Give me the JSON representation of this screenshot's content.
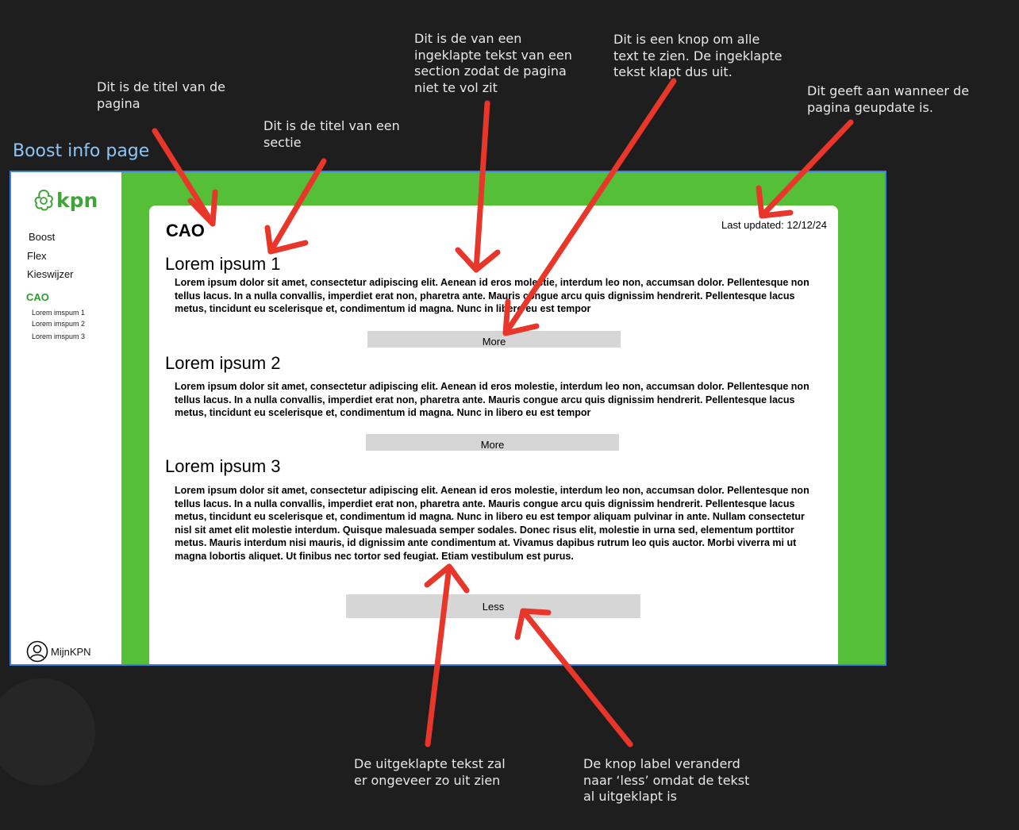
{
  "frame_title": "Boost info page",
  "colors": {
    "brand_green": "#55bf37",
    "frame_border": "#3b82e0",
    "arrow_red": "#e8362a"
  },
  "sidebar": {
    "logo_text": "kpn",
    "items": [
      {
        "label": "Boost"
      },
      {
        "label": "Flex"
      },
      {
        "label": "Kieswijzer"
      },
      {
        "label": "CAO",
        "active": true
      }
    ],
    "subitems": [
      {
        "label": "Lorem imspum 1"
      },
      {
        "label": "Lorem imspum 2"
      },
      {
        "label": "Lorem imspum 3"
      }
    ],
    "account_label": "MijnKPN"
  },
  "page": {
    "title": "CAO",
    "last_updated": "Last updated: 12/12/24",
    "sections": [
      {
        "title": "Lorem ipsum 1",
        "body": "Lorem ipsum dolor sit amet, consectetur adipiscing elit. Aenean id eros molestie, interdum leo non, accumsan dolor. Pellentesque non tellus lacus. In a nulla convallis, imperdiet erat non, pharetra ante. Mauris congue arcu quis dignissim hendrerit. Pellentesque lacus metus, tincidunt eu scelerisque et, condimentum id magna. Nunc in libero eu est tempor",
        "button": "More"
      },
      {
        "title": "Lorem ipsum 2",
        "body": "Lorem ipsum dolor sit amet, consectetur adipiscing elit. Aenean id eros molestie, interdum leo non, accumsan dolor. Pellentesque non tellus lacus. In a nulla convallis, imperdiet erat non, pharetra ante. Mauris congue arcu quis dignissim hendrerit. Pellentesque lacus metus, tincidunt eu scelerisque et, condimentum id magna. Nunc in libero eu est tempor",
        "button": "More"
      },
      {
        "title": "Lorem ipsum 3",
        "body": "Lorem ipsum dolor sit amet, consectetur adipiscing elit. Aenean id eros molestie, interdum leo non, accumsan dolor. Pellentesque non tellus lacus. In a nulla convallis, imperdiet erat non, pharetra ante. Mauris congue arcu quis dignissim hendrerit. Pellentesque lacus metus, tincidunt eu scelerisque et, condimentum id magna. Nunc in libero eu est tempor aliquam pulvinar in ante. Nullam consectetur nisl sit amet elit molestie interdum. Quisque malesuada semper sodales. Donec risus elit, molestie in urna sed, elementum porttitor metus. Mauris interdum nisi mauris, id dignissim ante condimentum at. Vivamus dapibus rutrum leo quis auctor. Morbi viverra mi ut magna lobortis aliquet. Ut finibus nec tortor sed feugiat. Etiam vestibulum est purus.",
        "button": "Less"
      }
    ]
  },
  "annotations": {
    "page_title": "Dit is de titel van de pagina",
    "section_title": "Dit is de titel van een sectie",
    "collapsed_text": "Dit is de van een ingeklapte tekst van een section zodat de pagina niet te vol zit",
    "button": "Dit is een knop om alle text te zien. De ingeklapte tekst klapt dus uit.",
    "updated": "Dit geeft aan wanneer de pagina geupdate is.",
    "expanded_text": "De uitgeklapte tekst zal er ongeveer zo uit zien",
    "less_label": "De knop label veranderd naar ‘less’ omdat de tekst al uitgeklapt is"
  }
}
